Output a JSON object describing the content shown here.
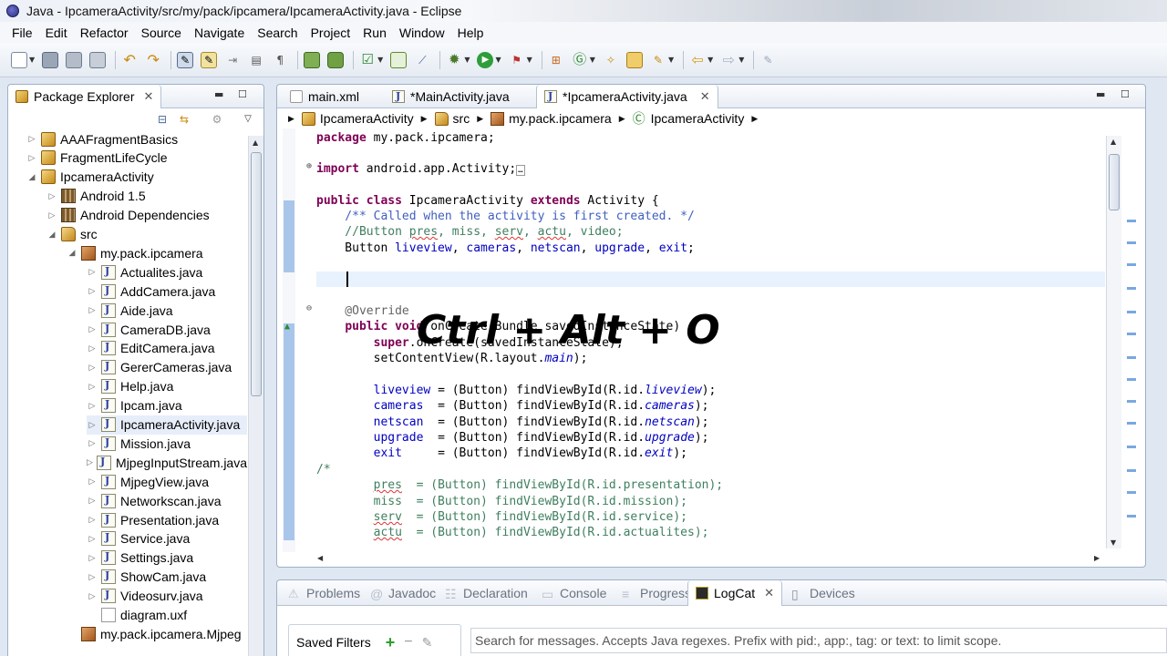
{
  "window": {
    "title": "Java - IpcameraActivity/src/my/pack/ipcamera/IpcameraActivity.java - Eclipse"
  },
  "menubar": {
    "items": [
      "File",
      "Edit",
      "Refactor",
      "Source",
      "Navigate",
      "Search",
      "Project",
      "Run",
      "Window",
      "Help"
    ]
  },
  "package_explorer": {
    "title": "Package Explorer",
    "items": [
      {
        "label": "AAAFragmentBasics",
        "icon": "project-icon",
        "level": 0,
        "twisty": "collapsed"
      },
      {
        "label": "FragmentLifeCycle",
        "icon": "project-icon",
        "level": 0,
        "twisty": "collapsed"
      },
      {
        "label": "IpcameraActivity",
        "icon": "project-icon",
        "level": 0,
        "twisty": "expanded"
      },
      {
        "label": "Android 1.5",
        "icon": "library-icon",
        "level": 1,
        "twisty": "collapsed"
      },
      {
        "label": "Android Dependencies",
        "icon": "library-icon",
        "level": 1,
        "twisty": "collapsed"
      },
      {
        "label": "src",
        "icon": "source-folder-icon",
        "level": 1,
        "twisty": "expanded"
      },
      {
        "label": "my.pack.ipcamera",
        "icon": "package-icon",
        "level": 2,
        "twisty": "expanded"
      },
      {
        "label": "Actualites.java",
        "icon": "java-file-icon",
        "level": 3,
        "twisty": "collapsed"
      },
      {
        "label": "AddCamera.java",
        "icon": "java-file-icon",
        "level": 3,
        "twisty": "collapsed"
      },
      {
        "label": "Aide.java",
        "icon": "java-file-icon",
        "level": 3,
        "twisty": "collapsed"
      },
      {
        "label": "CameraDB.java",
        "icon": "java-file-icon",
        "level": 3,
        "twisty": "collapsed"
      },
      {
        "label": "EditCamera.java",
        "icon": "java-file-icon",
        "level": 3,
        "twisty": "collapsed"
      },
      {
        "label": "GererCameras.java",
        "icon": "java-file-icon",
        "level": 3,
        "twisty": "collapsed"
      },
      {
        "label": "Help.java",
        "icon": "java-file-icon",
        "level": 3,
        "twisty": "collapsed"
      },
      {
        "label": "Ipcam.java",
        "icon": "java-file-icon",
        "level": 3,
        "twisty": "collapsed"
      },
      {
        "label": "IpcameraActivity.java",
        "icon": "java-file-icon",
        "level": 3,
        "twisty": "collapsed",
        "selected": true
      },
      {
        "label": "Mission.java",
        "icon": "java-file-icon",
        "level": 3,
        "twisty": "collapsed"
      },
      {
        "label": "MjpegInputStream.java",
        "icon": "java-file-icon",
        "level": 3,
        "twisty": "collapsed"
      },
      {
        "label": "MjpegView.java",
        "icon": "java-file-icon",
        "level": 3,
        "twisty": "collapsed"
      },
      {
        "label": "Networkscan.java",
        "icon": "java-file-icon",
        "level": 3,
        "twisty": "collapsed"
      },
      {
        "label": "Presentation.java",
        "icon": "java-file-icon",
        "level": 3,
        "twisty": "collapsed"
      },
      {
        "label": "Service.java",
        "icon": "java-file-icon",
        "level": 3,
        "twisty": "collapsed"
      },
      {
        "label": "Settings.java",
        "icon": "java-file-icon",
        "level": 3,
        "twisty": "collapsed"
      },
      {
        "label": "ShowCam.java",
        "icon": "java-file-icon",
        "level": 3,
        "twisty": "collapsed"
      },
      {
        "label": "Videosurv.java",
        "icon": "java-file-icon",
        "level": 3,
        "twisty": "collapsed"
      },
      {
        "label": "diagram.uxf",
        "icon": "file-icon",
        "level": 3,
        "twisty": "none"
      },
      {
        "label": "my.pack.ipcamera.Mjpeg",
        "icon": "package-icon",
        "level": 2,
        "twisty": "none"
      }
    ]
  },
  "editor": {
    "tabs": [
      {
        "label": "main.xml",
        "active": false
      },
      {
        "label": "*MainActivity.java",
        "active": false
      },
      {
        "label": "*IpcameraActivity.java",
        "active": true
      }
    ],
    "breadcrumb": [
      "IpcameraActivity",
      "src",
      "my.pack.ipcamera",
      "IpcameraActivity"
    ],
    "shortcut_overlay": "Ctrl + Alt + O"
  },
  "bottom_panel": {
    "tabs": [
      {
        "label": "Problems",
        "active": false
      },
      {
        "label": "Javadoc",
        "active": false
      },
      {
        "label": "Declaration",
        "active": false
      },
      {
        "label": "Console",
        "active": false
      },
      {
        "label": "Progress",
        "active": false
      },
      {
        "label": "LogCat",
        "active": true
      },
      {
        "label": "Devices",
        "active": false
      }
    ],
    "saved_filters_label": "Saved Filters",
    "search_placeholder": "Search for messages. Accepts Java regexes. Prefix with pid:, app:, tag: or text: to limit scope."
  }
}
